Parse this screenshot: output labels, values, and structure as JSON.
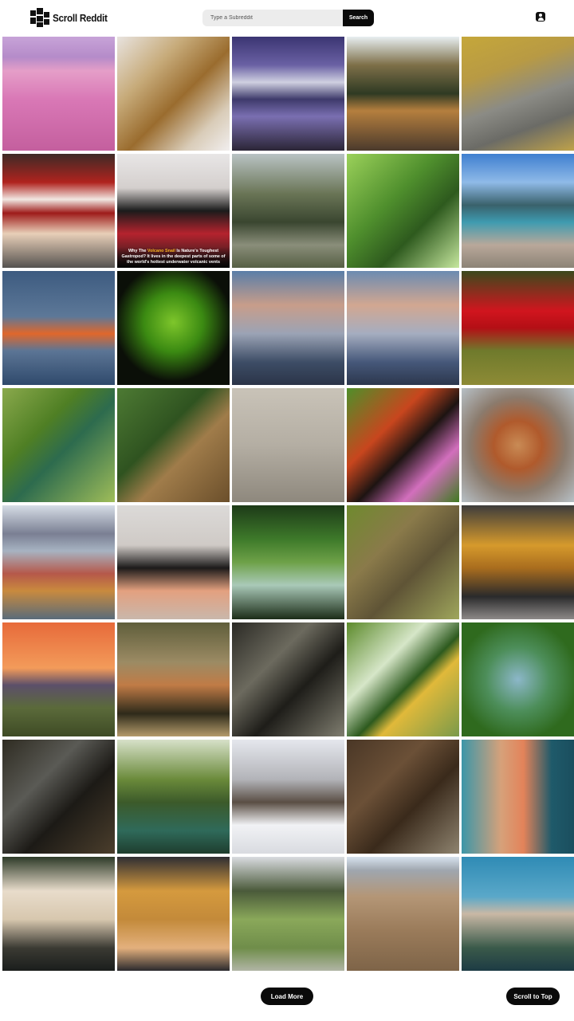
{
  "header": {
    "app_title": "Scroll Reddit",
    "search": {
      "placeholder": "Type a Subreddit",
      "value": "",
      "button_label": "Search"
    }
  },
  "gallery": {
    "tiles": [
      {
        "name": "photo-pink-blossom-valley-mountain",
        "bg": "linear-gradient(180deg,#c7a3d8 0%,#b58bc9 18%,#e59ec8 30%,#d978b6 55%,#c45f9e 100%)"
      },
      {
        "name": "photo-amur-leopard",
        "bg": "linear-gradient(135deg,#e8e3df 0%,#c7ab7a 30%,#9a6c2e 55%,#d9ccb8 80%,#f1eeee 100%)"
      },
      {
        "name": "photo-mountain-lake-reflection",
        "bg": "linear-gradient(180deg,#3b3572 0%,#6a61a4 25%,#cfd0e1 40%,#3e3a6b 55%,#7a6fb1 70%,#2b2536 100%)"
      },
      {
        "name": "photo-sunset-river-forest",
        "bg": "linear-gradient(180deg,#e7eef1 0%,#7d6f48 25%,#2f3a23 50%,#b57f3e 65%,#4b3a2c 100%)"
      },
      {
        "name": "photo-pallas-cat",
        "bg": "linear-gradient(160deg,#c5a73a 0%,#b89a44 30%,#8b8b85 55%,#6b6b66 75%,#bfa24a 100%)"
      },
      {
        "name": "photo-agate-slice",
        "bg": "linear-gradient(180deg,#3d2a26 0%,#b0231e 25%,#f1e7e2 40%,#9e1b1a 52%,#e8cfb8 70%,#55524f 100%)"
      },
      {
        "name": "photo-volcano-snail",
        "bg": "linear-gradient(180deg,#e8e6e6 0%,#d4cfcd 30%,#1b1b1b 50%,#b5232e 70%,#1a1a1a 100%)",
        "caption_parts": [
          "Why The ",
          "Volcano Snail",
          " Is Nature's Toughest Gastropod? It lives in the deepest parts of some of the world's hottest underwater volcanic vents"
        ]
      },
      {
        "name": "photo-owl-in-pine-tree",
        "bg": "linear-gradient(180deg,#b9c3c4 0%,#6a7556 35%,#3a4630 60%,#8a8e7a 80%,#565f44 100%)"
      },
      {
        "name": "photo-green-leaves",
        "bg": "linear-gradient(135deg,#9bd15a 0%,#4f8f2d 40%,#2e5a1e 65%,#c6e79e 100%)"
      },
      {
        "name": "photo-alpine-lake",
        "bg": "linear-gradient(180deg,#3f7fd0 0%,#8fbae8 25%,#39616b 45%,#3e9bb0 60%,#b9a89a 80%,#8c8376 100%)"
      },
      {
        "name": "photo-orange-octopus-water",
        "bg": "linear-gradient(180deg,#3d5b80 0%,#5d7898 40%,#e0672b 55%,#5c7595 70%,#2f4a6c 100%)"
      },
      {
        "name": "photo-green-katydid",
        "bg": "radial-gradient(circle at 50% 45%,#7ec62b 0%,#3b8a12 35%,#0b0f08 70%)"
      },
      {
        "name": "photo-rainbow-sky-a",
        "bg": "linear-gradient(180deg,#5a7ea8 0%,#c89d8a 30%,#9ba3b5 55%,#3d4d66 80%,#2b3448 100%)"
      },
      {
        "name": "photo-rainbow-sky-b",
        "bg": "linear-gradient(180deg,#6c8bb1 0%,#d2a791 30%,#a5adc0 55%,#46587a 80%,#2c374d 100%)"
      },
      {
        "name": "photo-red-slug-moss",
        "bg": "linear-gradient(180deg,#3c4a1d 0%,#d1151e 35%,#b30f15 50%,#6f7a2c 70%,#8e8b36 100%)"
      },
      {
        "name": "photo-blue-damselfly",
        "bg": "linear-gradient(135deg,#8aa94c 0%,#4f7f24 35%,#2d6b4e 55%,#9fbd59 100%)"
      },
      {
        "name": "photo-jaguar-collage",
        "bg": "linear-gradient(135deg,#4d7a33 0%,#2f5320 40%,#a07c4a 60%,#6b4f2b 100%)"
      },
      {
        "name": "photo-spider-web-ceiling",
        "bg": "linear-gradient(180deg,#c9c3b8 0%,#b4aea3 50%,#8e887d 100%)"
      },
      {
        "name": "photo-peacock-butterfly",
        "bg": "linear-gradient(135deg,#4f8f2a 0%,#c8461e 35%,#1d1412 55%,#d26fbd 75%,#3f7a21 100%)"
      },
      {
        "name": "photo-jumping-spider",
        "bg": "radial-gradient(circle at 50% 50%,#c98b55 0%,#b05a2c 30%,#8b7b6d 60%,#b7c0c6 100%)"
      },
      {
        "name": "photo-colorful-pebbles-lake",
        "bg": "linear-gradient(180deg,#d6dde6 0%,#7a7f93 25%,#a7b3c2 40%,#b5584a 60%,#c98a3e 75%,#5a6c7a 100%)"
      },
      {
        "name": "photo-hand-holding-reptiles",
        "bg": "linear-gradient(180deg,#dcdad8 0%,#cfcac6 35%,#1c1a1a 55%,#e3a07f 75%,#c9b7ab 100%)"
      },
      {
        "name": "photo-mossy-waterfall",
        "bg": "linear-gradient(180deg,#1d3a18 0%,#3e7a2a 30%,#6ea148 50%,#a9c9b8 70%,#1c2d18 100%)"
      },
      {
        "name": "photo-barred-owl",
        "bg": "linear-gradient(135deg,#6f8a2e 0%,#8a7a4a 35%,#5f5436 60%,#9fa65c 100%)"
      },
      {
        "name": "photo-orange-lobster-hand",
        "bg": "linear-gradient(180deg,#3d3c3c 0%,#d69a2c 35%,#a96d1e 55%,#2a2a2b 80%,#8d8988 100%)"
      },
      {
        "name": "photo-sunset-grassland",
        "bg": "linear-gradient(180deg,#e76a3a 0%,#f39b5a 40%,#5c4f6a 55%,#5b6a3a 75%,#3e4b25 100%)"
      },
      {
        "name": "photo-lizard-in-water",
        "bg": "linear-gradient(180deg,#5f5e3b 0%,#9c8b64 35%,#c07b46 55%,#2e2a1a 80%,#b49b6b 100%)"
      },
      {
        "name": "photo-crocodile-head",
        "bg": "linear-gradient(135deg,#2b2a25 0%,#6c6a5e 35%,#1e1d19 60%,#7f7d6f 100%)"
      },
      {
        "name": "photo-bumblebee-leaves",
        "bg": "linear-gradient(135deg,#5c8a2b 0%,#d6e6c8 35%,#2d5a1e 55%,#e0b93a 65%,#7a9a4a 100%)"
      },
      {
        "name": "photo-shrimp-underwater",
        "bg": "radial-gradient(circle at 50% 50%,#8cb7c9 0%,#4d8e5a 40%,#2f6a1e 75%)"
      },
      {
        "name": "photo-great-grey-owl",
        "bg": "linear-gradient(135deg,#2f2c22 0%,#5a5a55 35%,#1c1a16 60%,#4b3e2c 100%)"
      },
      {
        "name": "photo-bird-river-splash",
        "bg": "linear-gradient(180deg,#d7e1c9 0%,#6a8a3a 35%,#3c5a2a 55%,#2f6a5a 80%,#1e3d2e 100%)"
      },
      {
        "name": "photo-bear-snow-fish",
        "bg": "linear-gradient(180deg,#e5e7ed 0%,#b2b3b8 35%,#5a4e44 55%,#f1f2f5 75%,#d9dbe0 100%)"
      },
      {
        "name": "photo-tree-root-soil",
        "bg": "linear-gradient(135deg,#4a3726 0%,#6b5037 35%,#3a2a1b 60%,#8e836f 100%)"
      },
      {
        "name": "photo-sand-dune-coast",
        "bg": "linear-gradient(90deg,#3c96a8 0%,#d6a17a 35%,#e3835a 55%,#1f5a6a 80%,#1a4e5e 100%)"
      },
      {
        "name": "photo-spirit-bear",
        "bg": "linear-gradient(180deg,#2d3a28 0%,#e8dccb 30%,#d7c7ae 55%,#3b3a33 80%,#1a1e1c 100%)"
      },
      {
        "name": "photo-armadillo-balls",
        "bg": "linear-gradient(180deg,#2e2e33 0%,#d59a3e 30%,#c38a3a 55%,#e3b07d 80%,#2a2a2d 100%)"
      },
      {
        "name": "photo-grass-rocks",
        "bg": "linear-gradient(180deg,#d9dbe0 0%,#4a5a3a 30%,#8aa85a 55%,#6f8d4a 80%,#b1b5a5 100%)"
      },
      {
        "name": "photo-tire-tracks-field",
        "bg": "linear-gradient(180deg,#d7e2ee 0%,#9fa6ae 12%,#b49676 35%,#9a7b5a 65%,#7e6448 100%)"
      },
      {
        "name": "photo-sea-lion-underwater",
        "bg": "linear-gradient(180deg,#2f8bb5 0%,#5aa8c9 35%,#c9b8a5 50%,#3a5a4a 80%,#1d3b44 100%)"
      }
    ]
  },
  "footer": {
    "load_more_label": "Load More",
    "scroll_top_label": "Scroll to Top"
  }
}
